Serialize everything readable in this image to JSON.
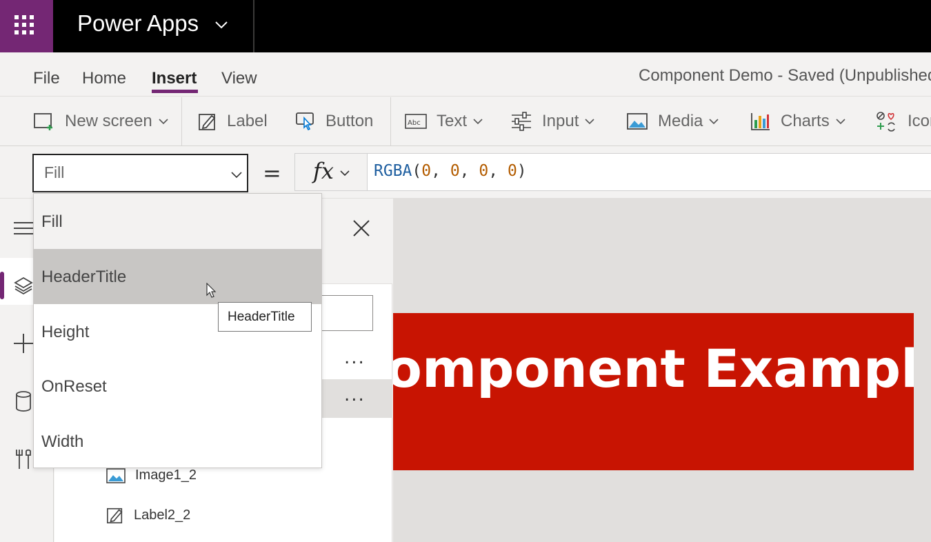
{
  "app": {
    "title": "Power Apps"
  },
  "menu": {
    "tabs": [
      {
        "label": "File"
      },
      {
        "label": "Home"
      },
      {
        "label": "Insert",
        "active": true
      },
      {
        "label": "View"
      }
    ],
    "doc_status": "Component Demo - Saved (Unpublished"
  },
  "ribbon": {
    "items": [
      {
        "label": "New screen",
        "icon": "new-screen-icon",
        "dropdown": true
      },
      {
        "label": "Label",
        "icon": "pencil-icon",
        "dropdown": false
      },
      {
        "label": "Button",
        "icon": "button-icon",
        "dropdown": false
      },
      {
        "label": "Text",
        "icon": "text-icon",
        "dropdown": true
      },
      {
        "label": "Input",
        "icon": "sliders-icon",
        "dropdown": true
      },
      {
        "label": "Media",
        "icon": "image-icon",
        "dropdown": true
      },
      {
        "label": "Charts",
        "icon": "chart-icon",
        "dropdown": true
      },
      {
        "label": "Icon",
        "icon": "icons-icon",
        "dropdown": false
      }
    ]
  },
  "formula": {
    "property": "Fill",
    "equals": "=",
    "fx": "fx",
    "fn": "RGBA",
    "args": [
      "0",
      "0",
      "0",
      "0"
    ]
  },
  "property_dropdown": {
    "options": [
      "Fill",
      "HeaderTitle",
      "Height",
      "OnReset",
      "Width"
    ],
    "hovered": "HeaderTitle"
  },
  "tooltip": {
    "text": "HeaderTitle"
  },
  "tree": {
    "more": "...",
    "items": [
      {
        "label": "Image1_2",
        "icon": "image-icon"
      },
      {
        "label": "Label2_2",
        "icon": "pencil-icon"
      }
    ]
  },
  "canvas": {
    "banner_text": "Component Example",
    "banner_color": "#c81402"
  },
  "colors": {
    "accent": "#742774",
    "topbar": "#000000"
  }
}
